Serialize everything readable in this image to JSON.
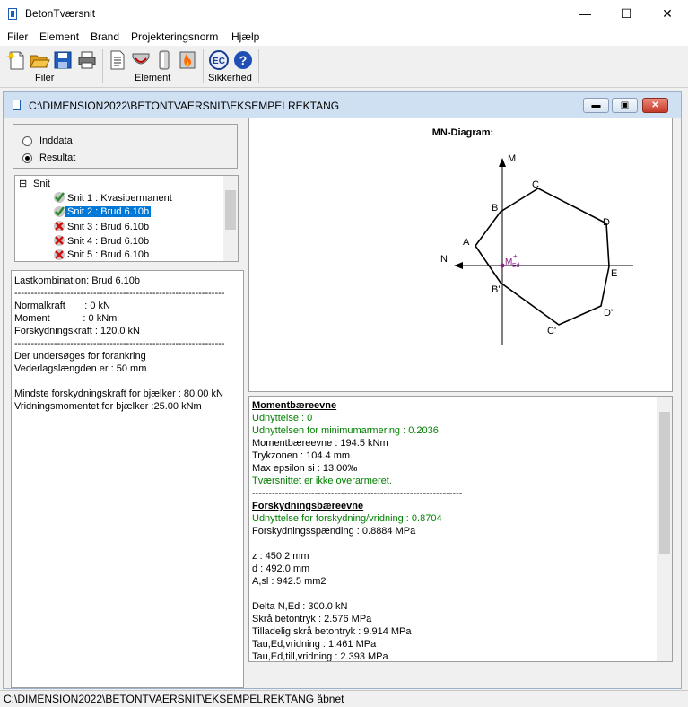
{
  "window": {
    "title": "BetonTværsnit",
    "minimize": "—",
    "maximize": "☐",
    "close": "✕"
  },
  "menu": [
    "Filer",
    "Element",
    "Brand",
    "Projekteringsnorm",
    "Hjælp"
  ],
  "toolbar": {
    "groups": [
      "Filer",
      "Element",
      "Sikkerhed"
    ],
    "icons": [
      "new-icon",
      "open-icon",
      "save-icon",
      "print-icon",
      "element-list-icon",
      "section-icon",
      "column-icon",
      "fire-icon",
      "ec-icon",
      "help-icon"
    ],
    "ec_label": "EC",
    "help_label": "?"
  },
  "mdi": {
    "title": "C:\\DIMENSION2022\\BETONTVAERSNIT\\EKSEMPELREKTANG",
    "min": "▬",
    "max": "▣",
    "close": "✕"
  },
  "mode": {
    "inddata": "Inddata",
    "resultat": "Resultat",
    "selected": "Resultat"
  },
  "tree": {
    "root": "Snit",
    "toggle": "⊟",
    "items": [
      {
        "label": "Snit 1 : Kvasipermanent",
        "status": "ok"
      },
      {
        "label": "Snit 2 : Brud 6.10b",
        "status": "ok",
        "selected": true
      },
      {
        "label": "Snit 3 : Brud 6.10b",
        "status": "fail"
      },
      {
        "label": "Snit 4 : Brud 6.10b",
        "status": "fail"
      },
      {
        "label": "Snit 5 : Brud 6.10b",
        "status": "fail"
      }
    ]
  },
  "left_text": {
    "l1": "Lastkombination: Brud 6.10b",
    "l2": "----------------------------------------------------------------",
    "l3": "Normalkraft       : 0 kN",
    "l4": "Moment            : 0 kNm",
    "l5": "Forskydningskraft : 120.0 kN",
    "l6": "----------------------------------------------------------------",
    "l7": "Der undersøges for forankring",
    "l8": "Vederlagslængden er : 50 mm",
    "l9": "Mindste forskydningskraft for bjælker : 80.00 kN",
    "l10": "Vridningsmomentet for bjælker :25.00 kNm"
  },
  "diagram": {
    "title": "MN-Diagram:",
    "axis_m": "M",
    "axis_n": "N",
    "med": "M",
    "med_sub": "Ed",
    "med_sup": "+",
    "points": [
      "A",
      "B",
      "C",
      "D",
      "E",
      "D'",
      "C'",
      "B'"
    ]
  },
  "results": {
    "h1": "Momentbæreevne",
    "r1": "Udnyttelse : 0",
    "r2": "Udnyttelsen for minimumarmering : 0.2036",
    "r3": "Momentbæreevne : 194.5 kNm",
    "r4": "Trykzonen : 104.4 mm",
    "r5": "Max epsilon si : 13.00‰",
    "r6": "Tværsnittet er ikke overarmeret.",
    "sep": "----------------------------------------------------------------",
    "h2": "Forskydningsbæreevne",
    "r7": "Udnyttelse for forskydning/vridning : 0.8704",
    "r8": "Forskydningsspænding : 0.8884 MPa",
    "r9": "z : 450.2 mm",
    "r10": "d : 492.0 mm",
    "r11": "A,sl : 942.5 mm2",
    "r12": "Delta N,Ed : 300.0 kN",
    "r13": "Skrå betontryk : 2.576 MPa",
    "r14": "Tilladelig skrå betontryk : 9.914 MPa",
    "r15": "Tau,Ed,vridning : 1.461 MPa",
    "r16": "Tau,Ed,till,vridning : 2.393 MPa"
  },
  "status": "C:\\DIMENSION2022\\BETONTVAERSNIT\\EKSEMPELREKTANG åbnet"
}
